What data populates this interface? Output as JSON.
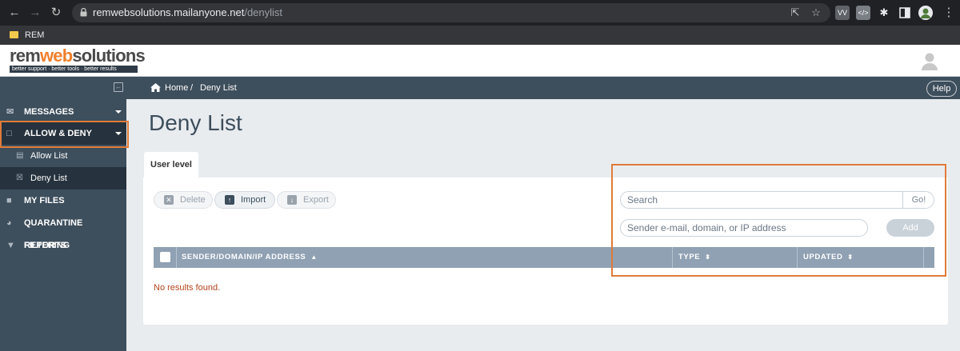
{
  "browser": {
    "url_host": "remwebsolutions.mailanyone.net",
    "url_path": "/denylist",
    "extension_vv": "VV",
    "bookmark_label": "REM"
  },
  "header": {
    "logo_text_left": "rem",
    "logo_text_accent": "web",
    "logo_text_right": "solutions",
    "logo_tagline": "better support · better tools · better results"
  },
  "sidebar": {
    "items": [
      {
        "label": "MESSAGES",
        "icon": "envelope-icon"
      },
      {
        "label": "ALLOW & DENY",
        "icon": "allow-deny-icon"
      },
      {
        "label": "Allow List",
        "icon": "allow-list-icon"
      },
      {
        "label": "Deny List",
        "icon": "deny-list-icon"
      },
      {
        "label": "MY FILES",
        "icon": "folder-icon"
      },
      {
        "label": "QUARANTINE REPORTS",
        "icon": "pie-chart-icon"
      },
      {
        "label": "FILTERING",
        "icon": "filter-icon"
      }
    ]
  },
  "breadcrumb": {
    "home": "Home",
    "separator": "/",
    "current": "Deny List"
  },
  "help_label": "Help",
  "page": {
    "title": "Deny List",
    "tab": "User level",
    "buttons": {
      "delete": "Delete",
      "import": "Import",
      "export": "Export"
    },
    "search_placeholder": "Search",
    "go_label": "Go!",
    "sender_placeholder": "Sender e-mail, domain, or IP address",
    "add_label": "Add",
    "columns": [
      "SENDER/DOMAIN/IP ADDRESS",
      "TYPE",
      "UPDATED"
    ],
    "sort_asc": "▲",
    "sort_both": "⬍",
    "empty_message": "No results found."
  },
  "colors": {
    "sidebar_bg": "#3d4e5c",
    "table_header": "#8fa1b3",
    "highlight": "#e07b39",
    "empty_text": "#b4441c"
  }
}
